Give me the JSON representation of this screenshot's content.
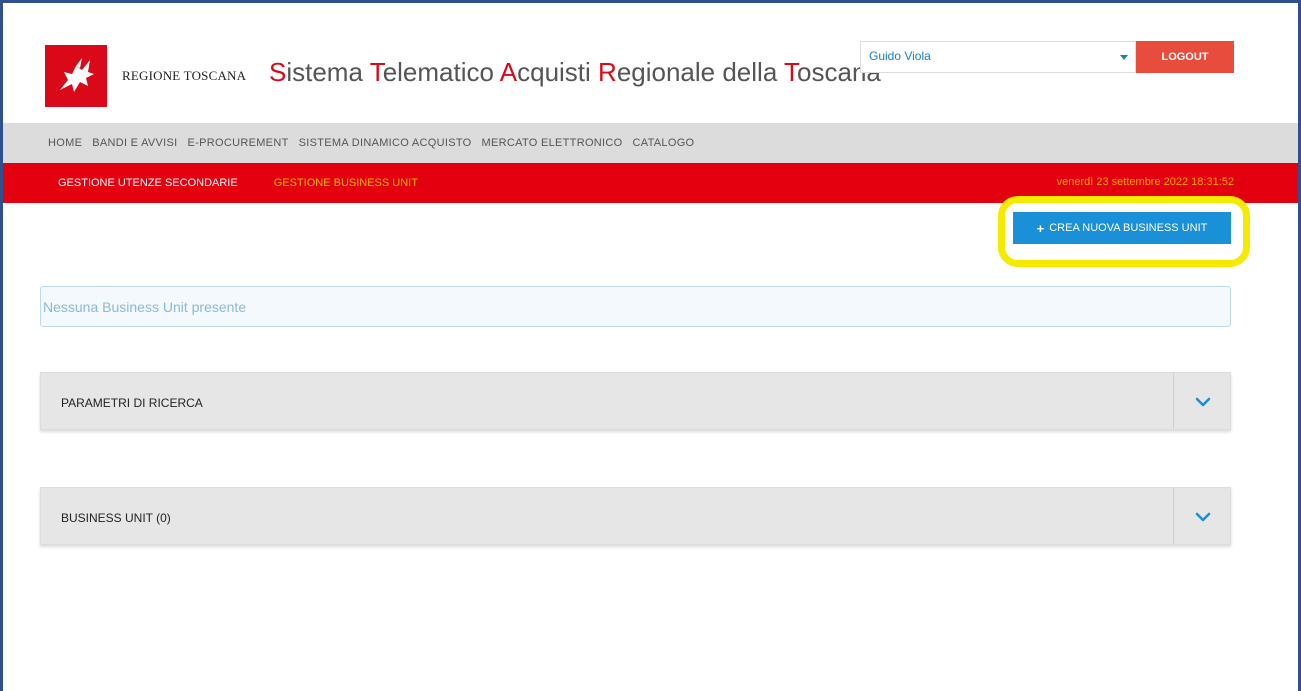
{
  "header": {
    "region_name": "REGIONE TOSCANA",
    "title_parts": [
      {
        "text": "S",
        "hl": true
      },
      {
        "text": "istema ",
        "hl": false
      },
      {
        "text": "T",
        "hl": true
      },
      {
        "text": "elematico ",
        "hl": false
      },
      {
        "text": "A",
        "hl": true
      },
      {
        "text": "cquisti ",
        "hl": false
      },
      {
        "text": "R",
        "hl": true
      },
      {
        "text": "egionale della ",
        "hl": false
      },
      {
        "text": "T",
        "hl": true
      },
      {
        "text": "oscana",
        "hl": false
      }
    ],
    "user_select_value": "Guido Viola",
    "logout_label": "LOGOUT"
  },
  "main_nav": {
    "items": [
      "HOME",
      "BANDI E AVVISI",
      "E-PROCUREMENT",
      "SISTEMA DINAMICO ACQUISTO",
      "MERCATO ELETTRONICO",
      "CATALOGO"
    ]
  },
  "sub_nav": {
    "items": [
      "GESTIONE UTENZE SECONDARIE",
      "GESTIONE BUSINESS UNIT"
    ],
    "active_index": 1,
    "datetime": "venerdì 23 settembre 2022 18:31:52"
  },
  "toolbar": {
    "create_label": "CREA NUOVA BUSINESS UNIT"
  },
  "info": {
    "message": "Nessuna Business Unit presente"
  },
  "panels": [
    {
      "title": "PARAMETRI DI RICERCA"
    },
    {
      "title": "BUSINESS UNIT (0)"
    }
  ],
  "colors": {
    "brand_red": "#e3000f",
    "accent_blue": "#1a90d9",
    "highlight_yellow": "#f5ea00",
    "logout_red": "#e74c3c"
  }
}
